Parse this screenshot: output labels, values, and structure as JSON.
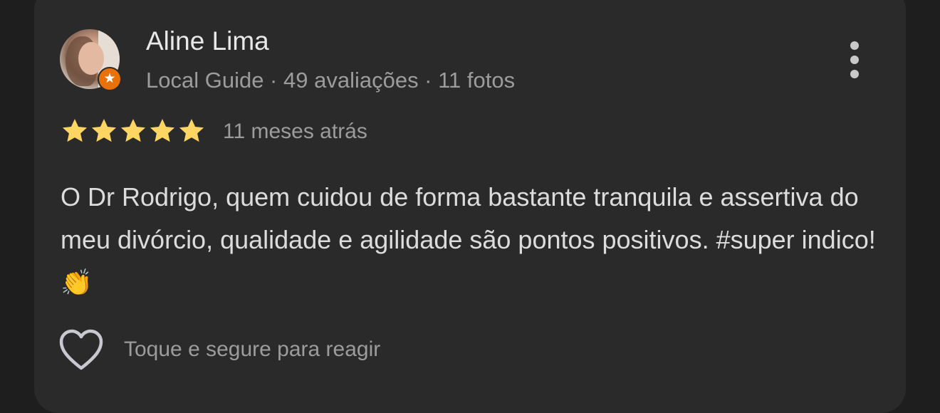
{
  "review": {
    "author_name": "Aline Lima",
    "author_meta": "Local Guide · 49 avaliações · 11 fotos",
    "rating": 5,
    "rating_max": 5,
    "time_ago": "11 meses atrás",
    "text": "O Dr Rodrigo, quem cuidou de forma bastante tranquila e assertiva do meu divórcio, qualidade e agilidade são pontos positivos. #super indico! 👏",
    "react_hint": "Toque e segure para reagir"
  },
  "icons": {
    "avatar": "profile-photo",
    "badge": "local-guide-star-icon",
    "more": "more-vert-icon",
    "star": "star-icon",
    "react": "heart-outline-icon"
  },
  "colors": {
    "star": "#fcd562",
    "badge": "#e8710a",
    "card_bg": "#2a2a2a",
    "page_bg": "#1e1e1e"
  }
}
